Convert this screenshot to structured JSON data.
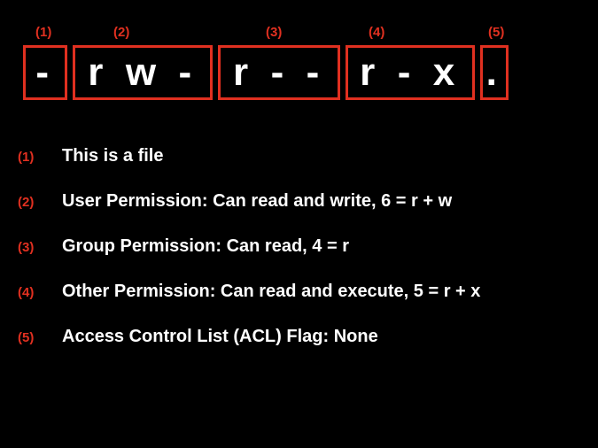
{
  "topLabels": {
    "l1": "(1)",
    "l2": "(2)",
    "l3": "(3)",
    "l4": "(4)",
    "l5": "(5)"
  },
  "boxes": {
    "b1": "-",
    "b2": "r w -",
    "b3": "r - -",
    "b4": "r - x",
    "b5": "."
  },
  "legend": {
    "r1": {
      "num": "(1)",
      "text": "This is a file"
    },
    "r2": {
      "num": "(2)",
      "text": "User Permission: Can read and write, 6 = r + w"
    },
    "r3": {
      "num": "(3)",
      "text": "Group Permission: Can read, 4 = r"
    },
    "r4": {
      "num": "(4)",
      "text": "Other Permission: Can read and execute, 5 = r + x"
    },
    "r5": {
      "num": "(5)",
      "text": "Access Control List (ACL) Flag: None"
    }
  }
}
